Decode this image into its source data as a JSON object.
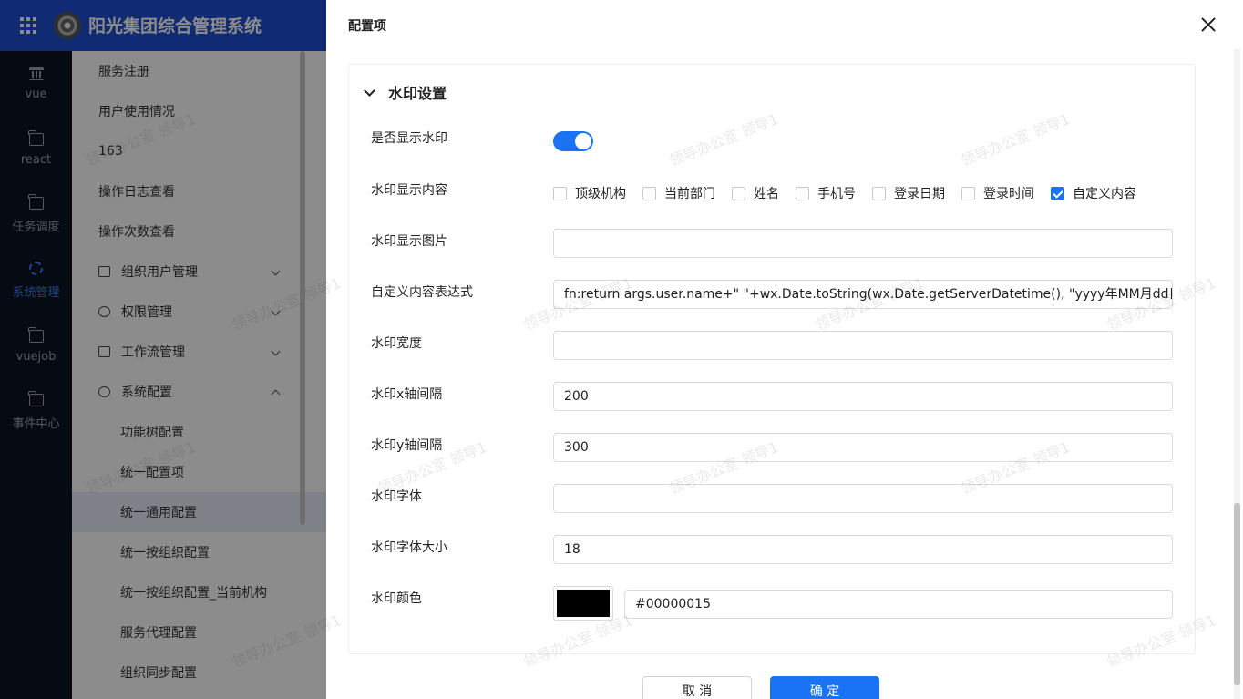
{
  "header": {
    "title": "阳光集团综合管理系统"
  },
  "rail": {
    "items": [
      {
        "label": "vue",
        "icon": "bank-icon"
      },
      {
        "label": "react",
        "icon": "folder-icon"
      },
      {
        "label": "任务调度",
        "icon": "folder-icon"
      },
      {
        "label": "系统管理",
        "icon": "gear-icon",
        "active": true
      },
      {
        "label": "vuejob",
        "icon": "folder-icon"
      },
      {
        "label": "事件中心",
        "icon": "folder-icon"
      }
    ]
  },
  "menu": {
    "items": [
      "服务注册",
      "用户使用情况",
      "163",
      "操作日志查看",
      "操作次数查看",
      "组织用户管理",
      "权限管理",
      "工作流管理",
      "系统配置",
      "功能树配置",
      "统一配置项",
      "统一通用配置",
      "统一按组织配置",
      "统一按组织配置_当前机构",
      "服务代理配置",
      "组织同步配置"
    ]
  },
  "drawer": {
    "title": "配置项",
    "section_title": "水印设置",
    "labels": {
      "show": "是否显示水印",
      "content": "水印显示内容",
      "image": "水印显示图片",
      "expr": "自定义内容表达式",
      "width": "水印宽度",
      "x_gap": "水印x轴间隔",
      "y_gap": "水印y轴间隔",
      "font": "水印字体",
      "font_size": "水印字体大小",
      "color": "水印颜色"
    },
    "show_enabled": true,
    "content_options": [
      {
        "label": "顶级机构",
        "checked": false
      },
      {
        "label": "当前部门",
        "checked": false
      },
      {
        "label": "姓名",
        "checked": false
      },
      {
        "label": "手机号",
        "checked": false
      },
      {
        "label": "登录日期",
        "checked": false
      },
      {
        "label": "登录时间",
        "checked": false
      },
      {
        "label": "自定义内容",
        "checked": true
      }
    ],
    "values": {
      "image": "",
      "expr": "fn:return args.user.name+\" \"+wx.Date.toString(wx.Date.getServerDatetime(), \"yyyy年MM月dd日\")",
      "width": "",
      "x_gap": "200",
      "y_gap": "300",
      "font": "",
      "font_size": "18",
      "color": "#00000015"
    },
    "swatch_color": "#000000",
    "buttons": {
      "cancel": "取 消",
      "ok": "确 定"
    }
  },
  "watermark": {
    "text": "领导办公室 领导1"
  },
  "colors": {
    "primary": "#1a73f5",
    "header": "#1e4fd1",
    "rail": "#0c1424"
  }
}
